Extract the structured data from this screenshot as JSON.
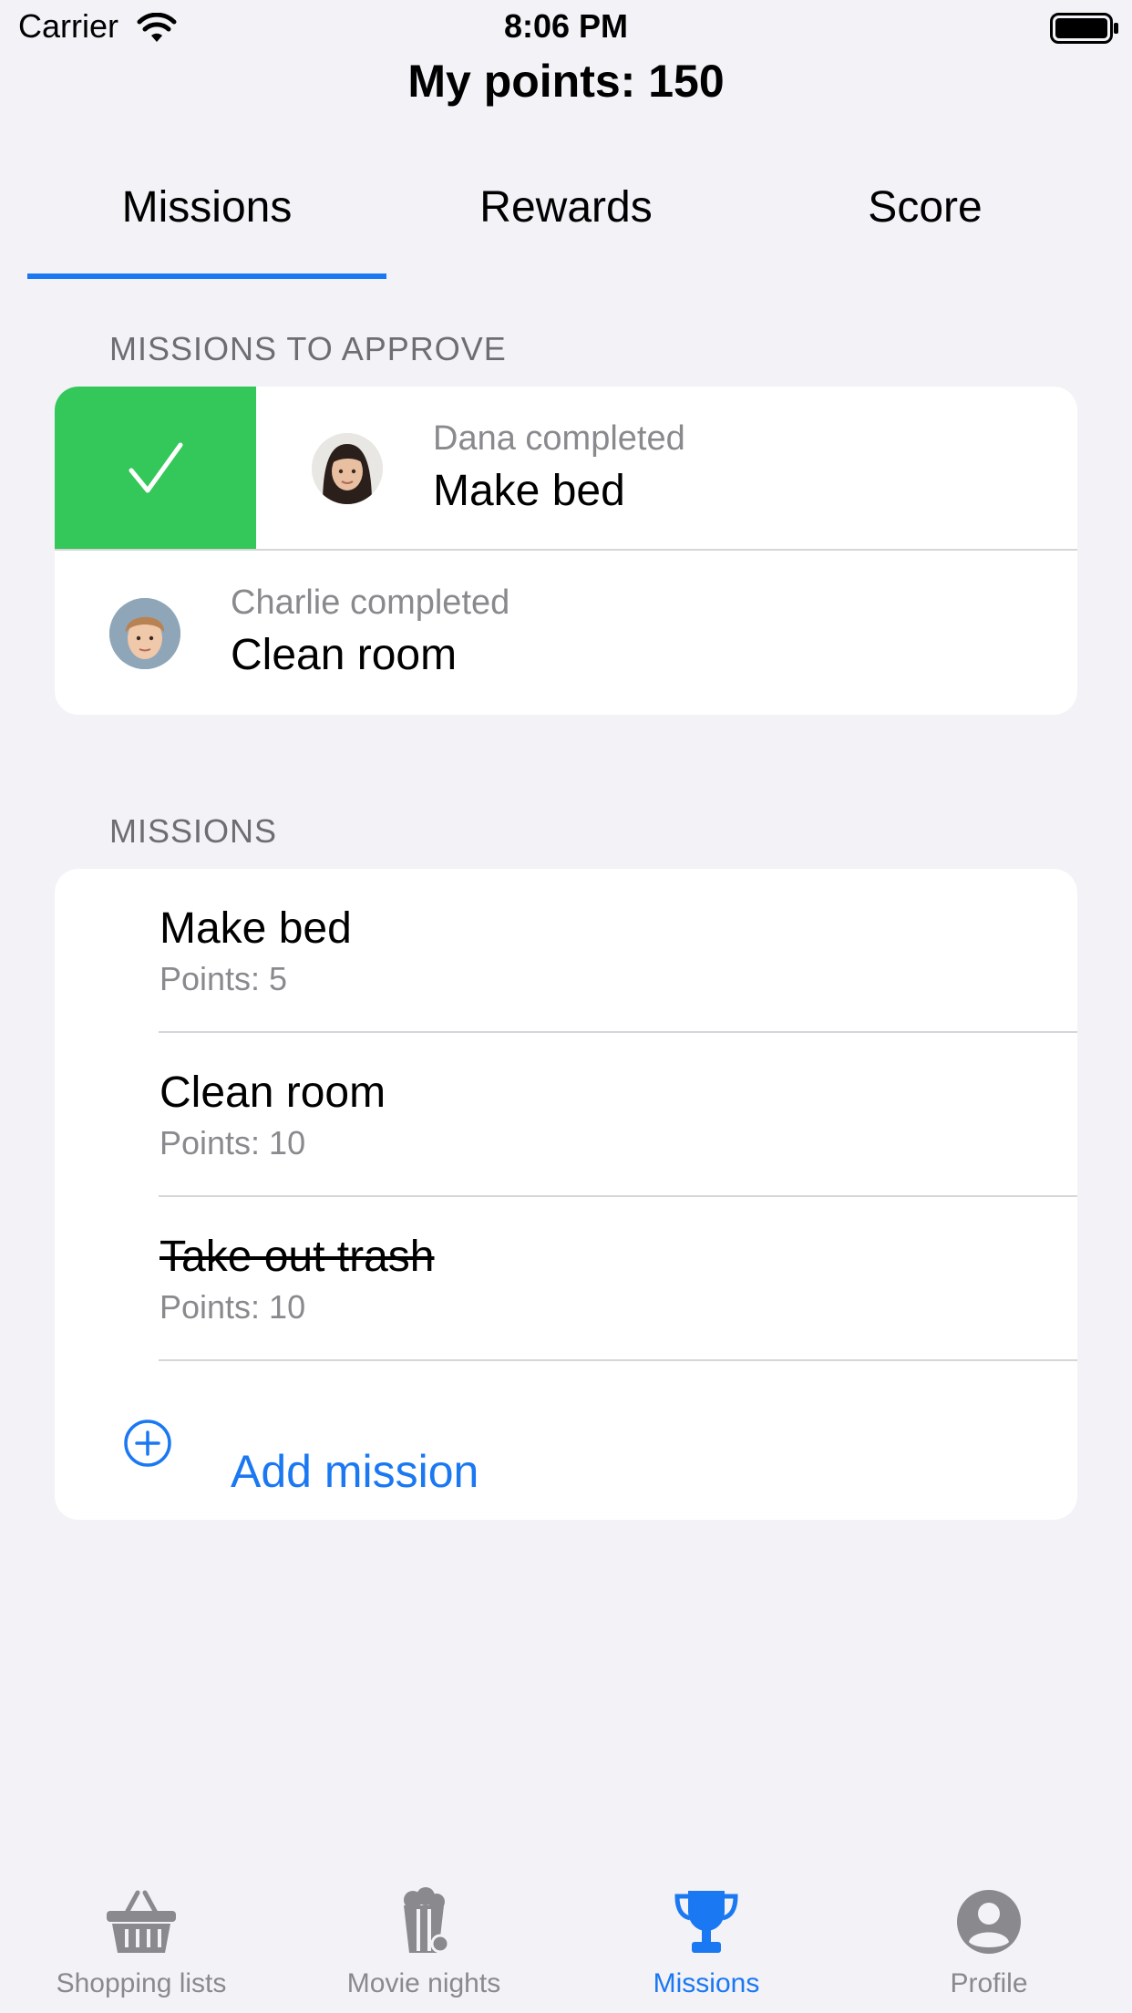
{
  "status_bar": {
    "carrier": "Carrier",
    "time": "8:06 PM"
  },
  "header": {
    "title": "My points: 150"
  },
  "tabs": [
    {
      "label": "Missions",
      "active": true
    },
    {
      "label": "Rewards",
      "active": false
    },
    {
      "label": "Score",
      "active": false
    }
  ],
  "approve_section": {
    "header": "MISSIONS TO APPROVE",
    "items": [
      {
        "who": "Dana completed",
        "mission": "Make bed"
      },
      {
        "who": "Charlie completed",
        "mission": "Clean room"
      }
    ]
  },
  "missions_section": {
    "header": "MISSIONS",
    "items": [
      {
        "name": "Make bed",
        "points": "Points: 5",
        "done": false
      },
      {
        "name": "Clean room",
        "points": "Points: 10",
        "done": false
      },
      {
        "name": "Take out trash",
        "points": "Points: 10",
        "done": true
      }
    ],
    "add_label": "Add mission"
  },
  "tab_bar": [
    {
      "label": "Shopping lists",
      "icon": "basket-icon",
      "active": false
    },
    {
      "label": "Movie nights",
      "icon": "popcorn-icon",
      "active": false
    },
    {
      "label": "Missions",
      "icon": "trophy-icon",
      "active": true
    },
    {
      "label": "Profile",
      "icon": "person-circle-icon",
      "active": false
    }
  ],
  "colors": {
    "accent": "#1a78f2",
    "approve_green": "#34c759",
    "background": "#f2f2f7"
  }
}
